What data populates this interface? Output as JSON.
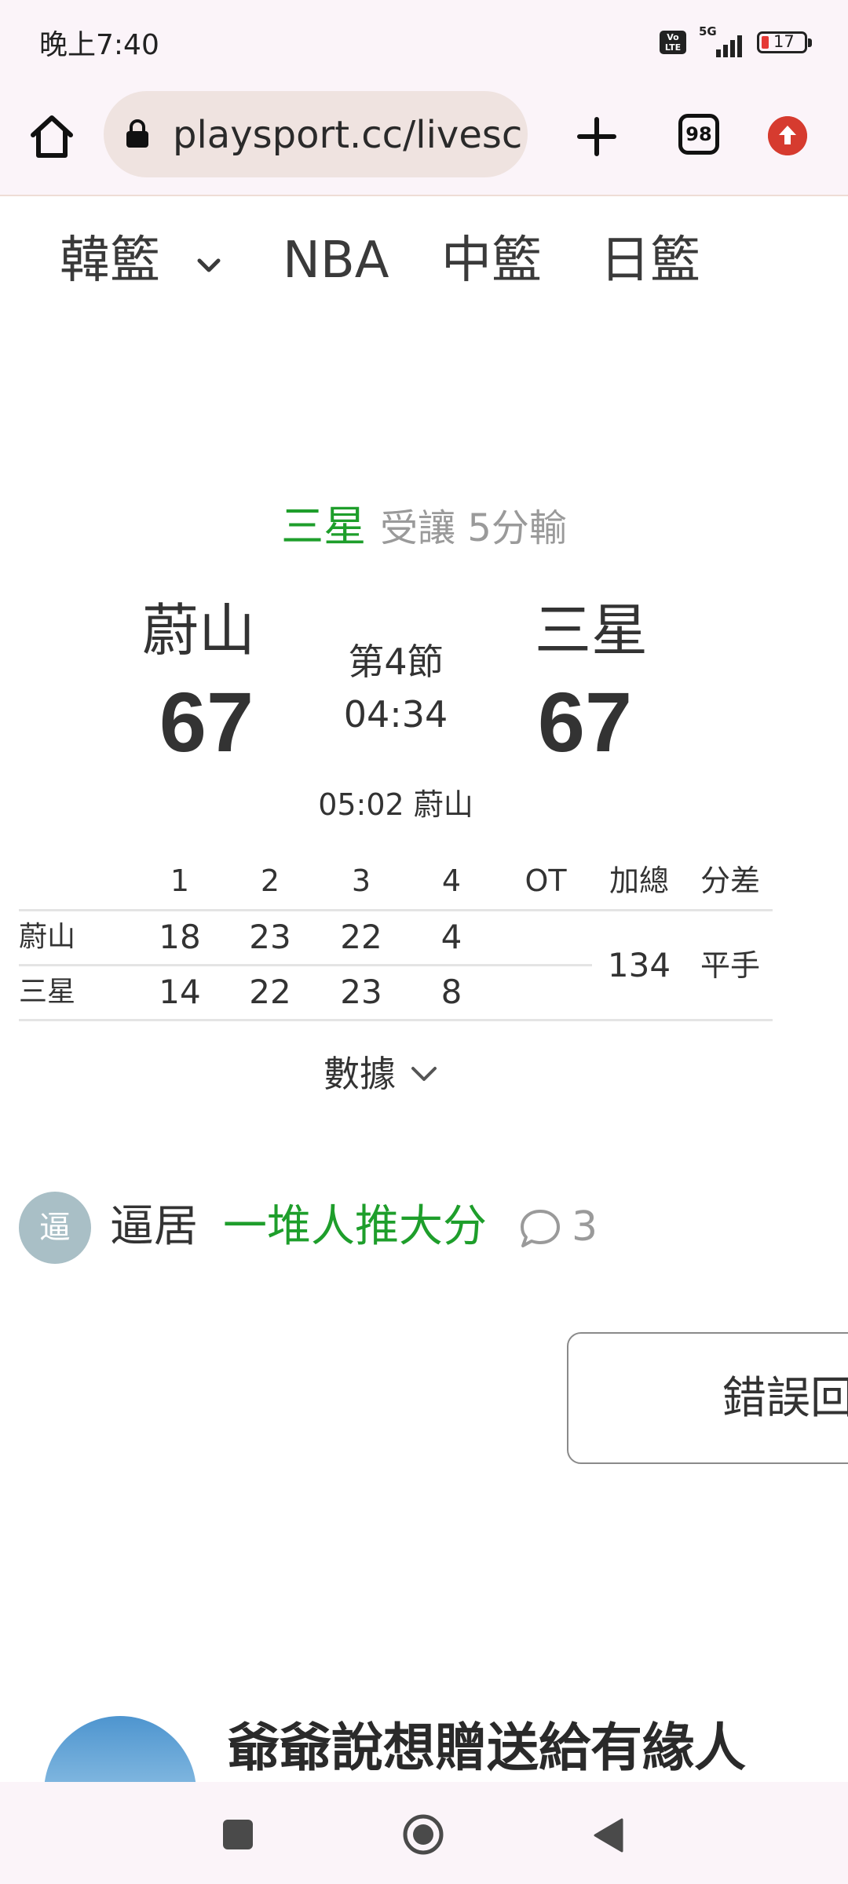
{
  "status_bar": {
    "time": "晚上7:40",
    "volte": "Vo LTE",
    "network": "5G",
    "battery": "17"
  },
  "browser": {
    "url": "playsport.cc/livesc",
    "tab_count": "98"
  },
  "league_nav": {
    "items": [
      "韓籃",
      "NBA",
      "中籃",
      "日籃"
    ]
  },
  "game": {
    "handicap_team": "三星",
    "handicap_info": "受讓 5分輸",
    "home_team": "蔚山",
    "away_team": "三星",
    "home_score": "67",
    "away_score": "67",
    "period": "第4節",
    "clock": "04:34",
    "last_event": "05:02 蔚山"
  },
  "quarter_table": {
    "headers": [
      "1",
      "2",
      "3",
      "4",
      "OT",
      "加總",
      "分差"
    ],
    "rows": [
      {
        "team": "蔚山",
        "q1": "18",
        "q2": "23",
        "q3": "22",
        "q4": "4",
        "ot": ""
      },
      {
        "team": "三星",
        "q1": "14",
        "q2": "22",
        "q3": "23",
        "q4": "8",
        "ot": ""
      }
    ],
    "total": "134",
    "diff": "平手"
  },
  "stats_toggle": {
    "label": "數據"
  },
  "comment": {
    "avatar_text": "逼",
    "user": "逼居",
    "text": "一堆人推大分",
    "count": "3"
  },
  "error_report": {
    "label": "錯誤回"
  },
  "promo": {
    "title": "爺爺說想贈送給有緣人"
  },
  "colors": {
    "accent_green": "#1e9e2b",
    "upload_red": "#d63b2f",
    "muted_text": "#9a9a9a"
  }
}
